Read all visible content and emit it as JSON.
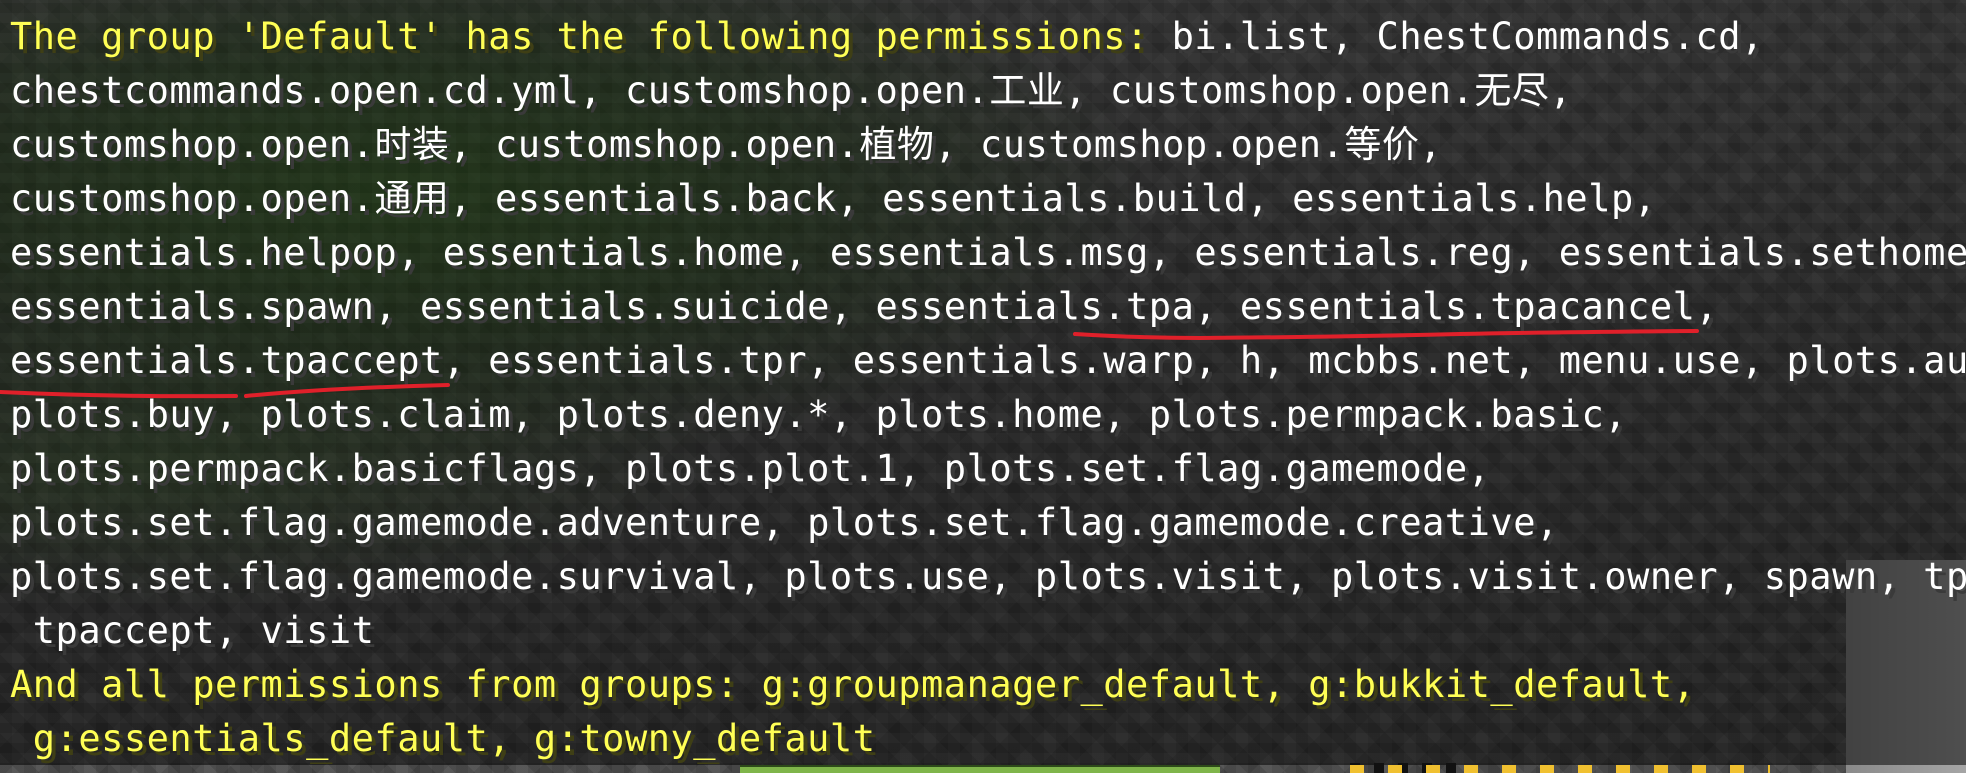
{
  "chat": {
    "lines": [
      {
        "prefix": "The group 'Default' has the following permissions: ",
        "text": "bi.list, ChestCommands.cd,"
      },
      {
        "prefix": "",
        "text": "chestcommands.open.cd.yml, customshop.open.工业, customshop.open.无尽,"
      },
      {
        "prefix": "",
        "text": "customshop.open.时装, customshop.open.植物, customshop.open.等价,"
      },
      {
        "prefix": "",
        "text": "customshop.open.通用, essentials.back, essentials.build, essentials.help,"
      },
      {
        "prefix": "",
        "text": "essentials.helpop, essentials.home, essentials.msg, essentials.reg, essentials.sethome,"
      },
      {
        "prefix": "",
        "text": "essentials.spawn, essentials.suicide, essentials.tpa, essentials.tpacancel,"
      },
      {
        "prefix": "",
        "text": "essentials.tpaccept, essentials.tpr, essentials.warp, h, mcbbs.net, menu.use, plots.auto,"
      },
      {
        "prefix": "",
        "text": "plots.buy, plots.claim, plots.deny.*, plots.home, plots.permpack.basic,"
      },
      {
        "prefix": "",
        "text": "plots.permpack.basicflags, plots.plot.1, plots.set.flag.gamemode,"
      },
      {
        "prefix": "",
        "text": "plots.set.flag.gamemode.adventure, plots.set.flag.gamemode.creative,"
      },
      {
        "prefix": "",
        "text": "plots.set.flag.gamemode.survival, plots.use, plots.visit, plots.visit.owner, spawn, tpa,"
      },
      {
        "prefix": "",
        "text": " tpaccept, visit"
      },
      {
        "prefix": "And all permissions from groups: g:groupmanager_default, g:bukkit_default,",
        "text": ""
      },
      {
        "prefix": " g:essentials_default, g:towny_default",
        "text": ""
      }
    ],
    "colors": {
      "header": "#ffff55",
      "body": "#ffffff",
      "annotation": "#e0202a"
    }
  }
}
